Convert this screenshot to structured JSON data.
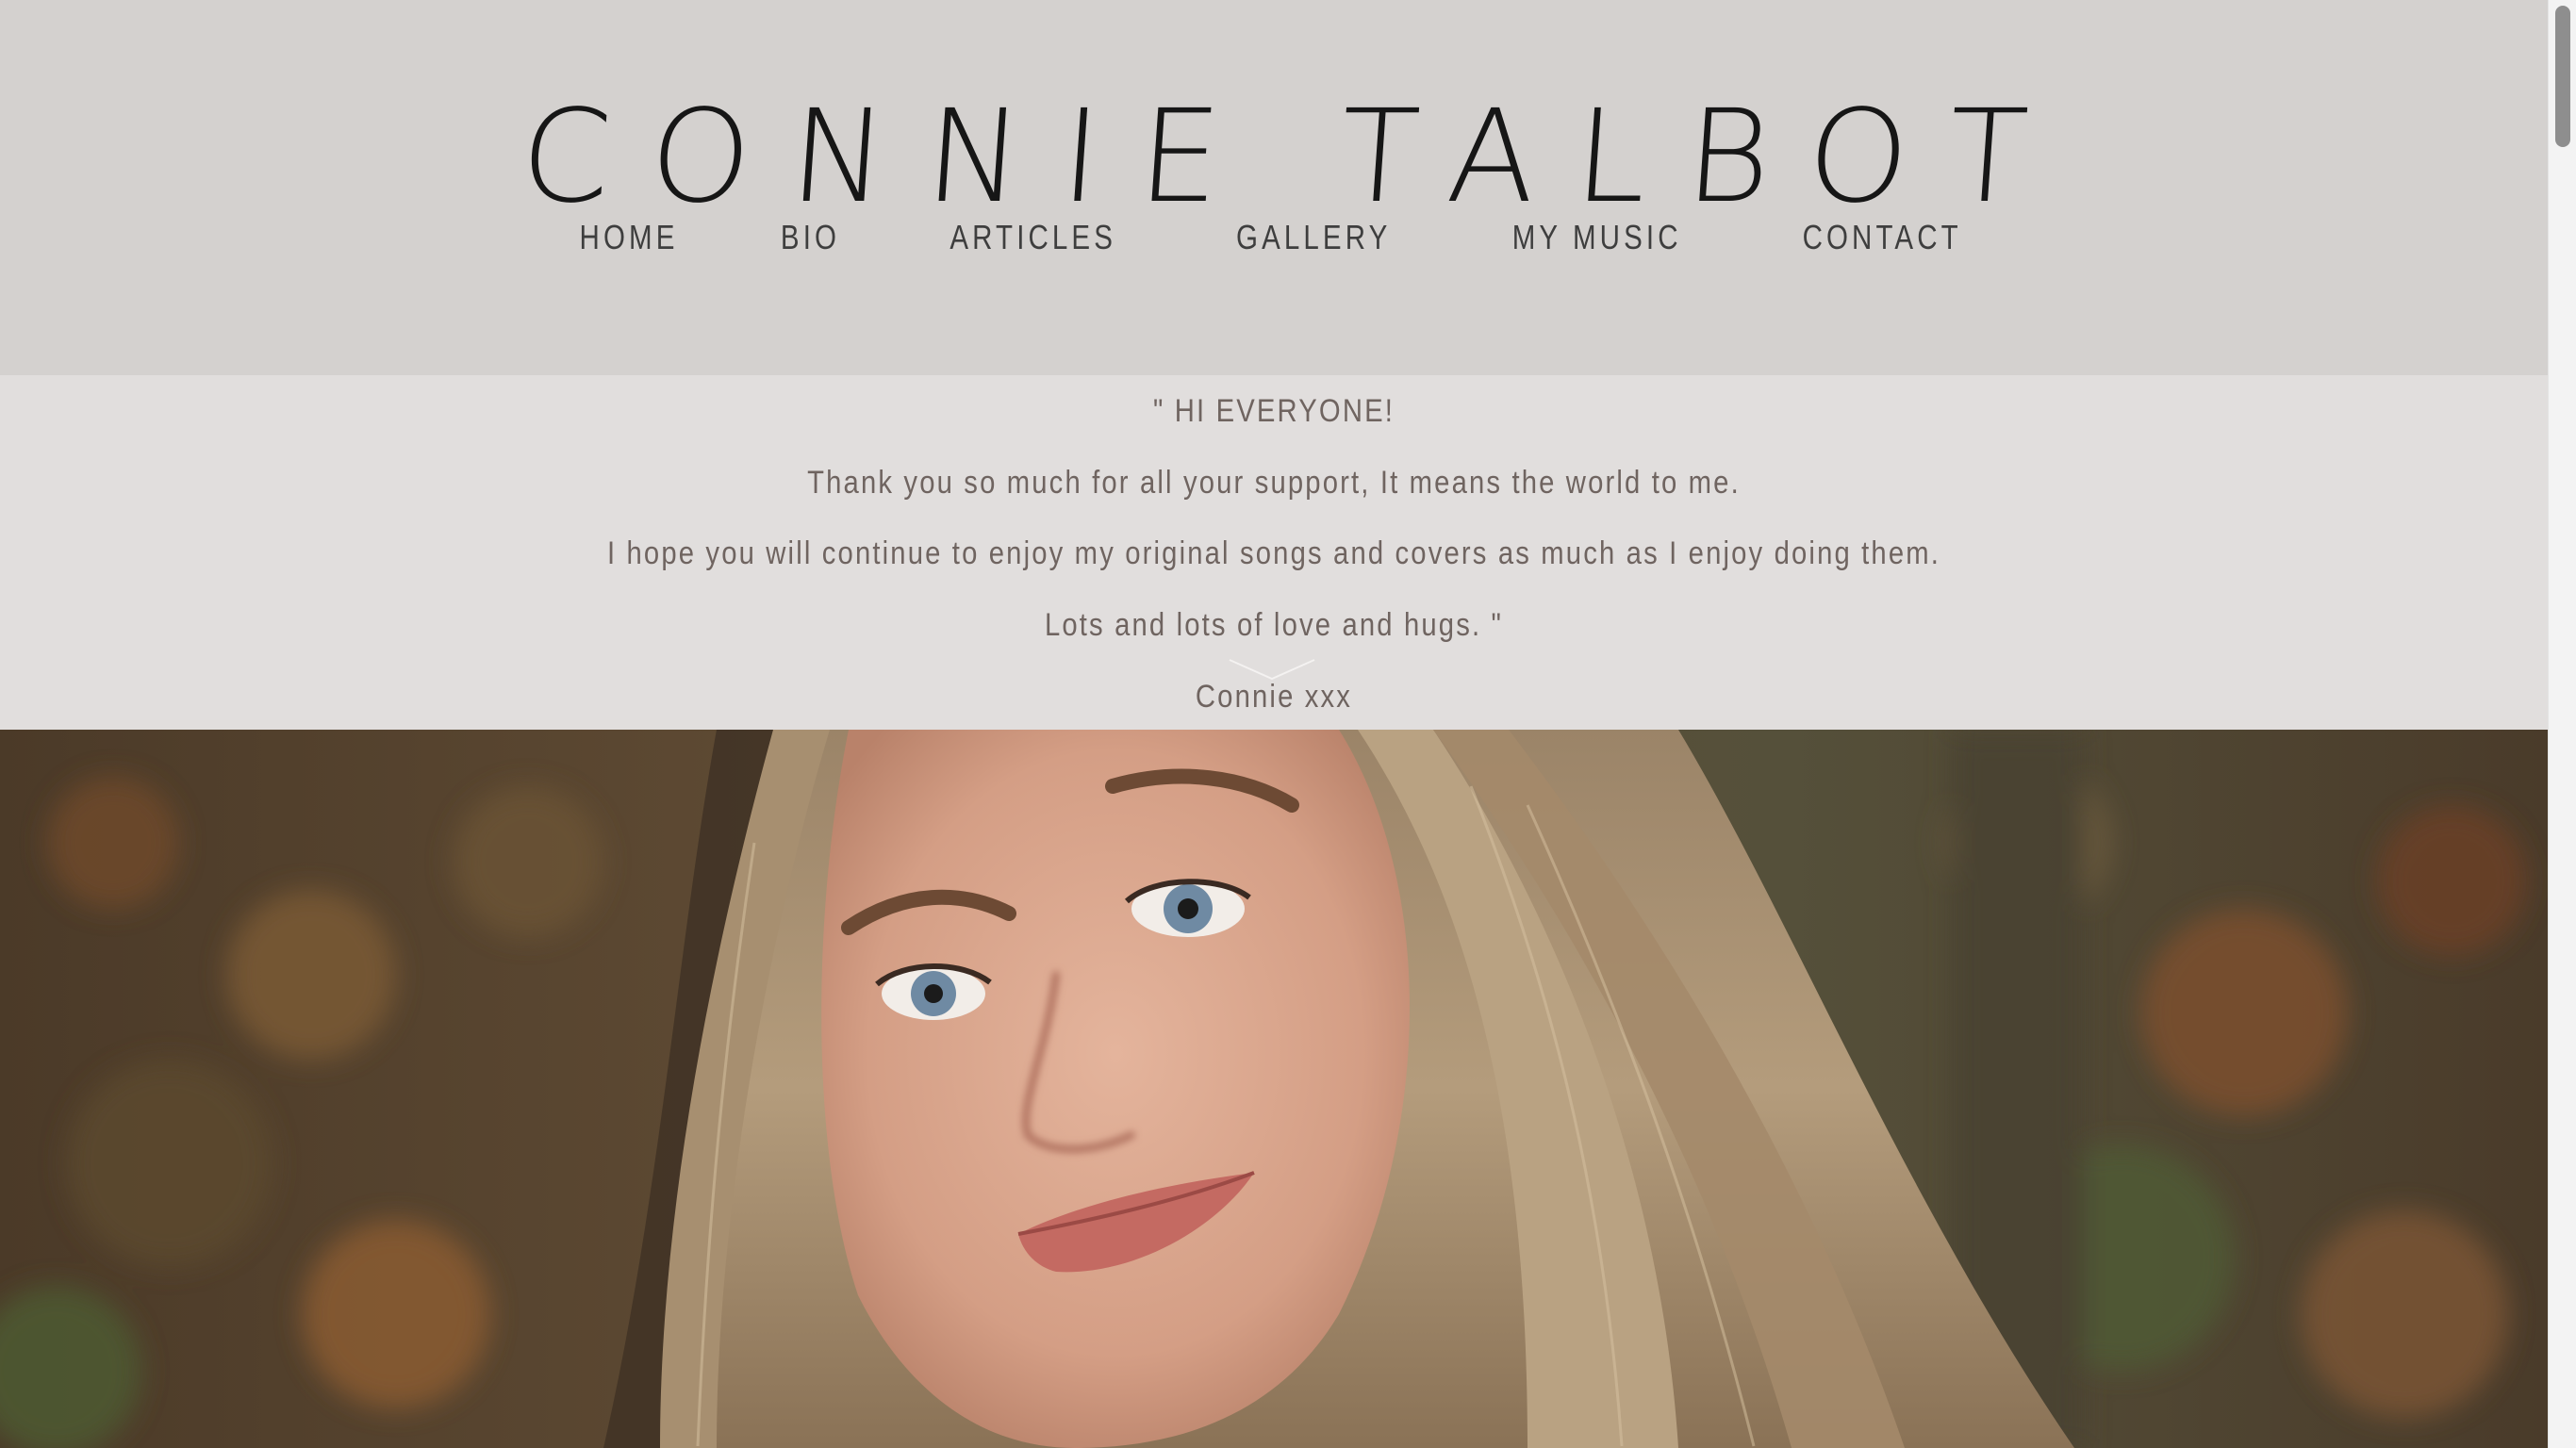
{
  "header": {
    "site_title": "CONNIE TALBOT",
    "nav": [
      {
        "label": "HOME"
      },
      {
        "label": "BIO"
      },
      {
        "label": "ARTICLES"
      },
      {
        "label": "GALLERY"
      },
      {
        "label": "MY MUSIC"
      },
      {
        "label": "CONTACT"
      }
    ]
  },
  "welcome": {
    "lines": [
      "\" HI EVERYONE!",
      "Thank you so much for all your support, It means the world to me.",
      "I hope you will continue to enjoy my original songs and covers as much as I enjoy doing them.",
      "Lots and lots of love and hugs. \"",
      "Connie xxx"
    ]
  },
  "hero": {
    "image": "portrait photo of a smiling young woman with long blonde hair against an autumn foliage background"
  },
  "colors": {
    "header_bg": "#d4d1cf",
    "quote_bg": "#e1dedd",
    "title_text": "#161616",
    "nav_text": "#3e3e3e",
    "quote_text": "#6f6460"
  },
  "icons": {
    "scroll_down": "chevron-down-icon"
  }
}
